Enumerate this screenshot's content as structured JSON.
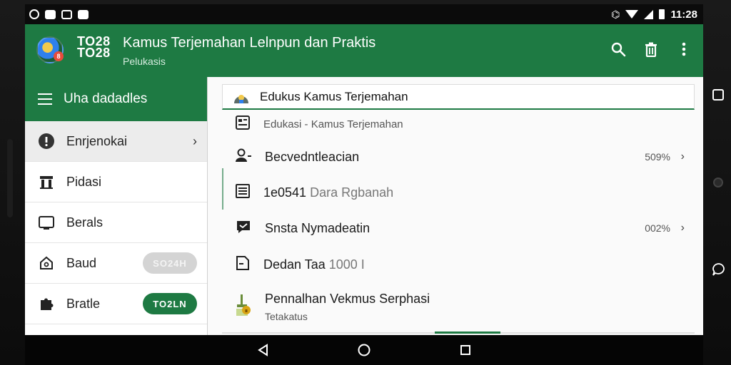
{
  "status_bar": {
    "time": "11:28",
    "left_icons": [
      "android-debug-icon",
      "photo-icon",
      "chat-icon",
      "image-icon"
    ],
    "right_icons": [
      "nfc-icon",
      "wifi-icon",
      "signal-icon",
      "battery-icon"
    ]
  },
  "app_bar": {
    "code": "TO28\nTO28",
    "title": "Kamus Terjemahan Lelnpun dan Praktis",
    "subtitle": "Pelukasis",
    "actions": [
      "search-icon",
      "delete-icon",
      "more-icon"
    ]
  },
  "drawer": {
    "title": "Uha dadadles",
    "items": [
      {
        "label": "Enrjenokai",
        "icon": "info-icon",
        "chevron": "›",
        "active": true
      },
      {
        "label": "Pidasi",
        "icon": "building-icon"
      },
      {
        "label": "Berals",
        "icon": "monitor-icon"
      },
      {
        "label": "Baud",
        "icon": "home-icon",
        "pill": "SO24H",
        "pill_style": "grey"
      },
      {
        "label": "Bratle",
        "icon": "puzzle-icon",
        "pill": "TO2LN",
        "pill_style": "green"
      }
    ]
  },
  "main": {
    "header": {
      "title": "Edukus Kamus Terjemahan"
    },
    "rows": [
      {
        "label": "Edukasi - Kamus Terjemahan",
        "icon": "calendar-icon",
        "small": true
      },
      {
        "label": "Becvedntleacian",
        "icon": "person-icon",
        "value": "509%",
        "chevron": "›"
      },
      {
        "label": "1e0541",
        "label_extra": "Dara Rgbanah",
        "icon": "list-icon"
      },
      {
        "label": "Snsta Nymadeatin",
        "icon": "message-icon",
        "value": "002%",
        "chevron": "›"
      },
      {
        "label": "Dedan Taa",
        "label_extra": "1000  I",
        "icon": "file-icon"
      },
      {
        "label": "Pennalhan Vekmus Serphasi",
        "sub": "Tetakatus",
        "icon": "lock-tree-icon"
      }
    ]
  },
  "nav_bar": [
    "back-icon",
    "home-icon",
    "recents-icon"
  ],
  "colors": {
    "primary": "#1e7a43",
    "status_bar": "#0b0b0b",
    "background": "#fafafa"
  }
}
